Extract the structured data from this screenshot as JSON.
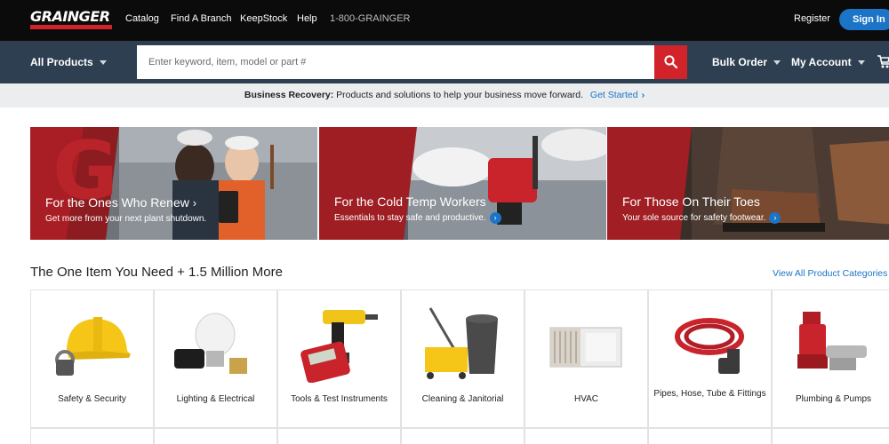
{
  "header": {
    "logo": "GRAINGER",
    "links": [
      "Catalog",
      "Find A Branch",
      "KeepStock",
      "Help"
    ],
    "phone": "1-800-GRAINGER",
    "register": "Register",
    "signin": "Sign In"
  },
  "nav": {
    "all_products": "All Products",
    "search_placeholder": "Enter keyword, item, model or part #",
    "bulk_order": "Bulk Order",
    "my_account": "My Account"
  },
  "banner": {
    "bold": "Business Recovery:",
    "text": "Products and solutions to help your business move forward.",
    "link": "Get Started"
  },
  "promos": [
    {
      "title": "For the Ones Who Renew",
      "subtitle": "Get more from your next plant shutdown."
    },
    {
      "title": "For the Cold Temp Workers",
      "subtitle": "Essentials to stay safe and productive."
    },
    {
      "title": "For Those On Their Toes",
      "subtitle": "Your sole source for safety footwear."
    }
  ],
  "section": {
    "title": "The One Item You Need + 1.5 Million More",
    "view_all": "View All Product Categories"
  },
  "categories": [
    {
      "label": "Safety & Security"
    },
    {
      "label": "Lighting & Electrical"
    },
    {
      "label": "Tools & Test Instruments"
    },
    {
      "label": "Cleaning & Janitorial"
    },
    {
      "label": "HVAC"
    },
    {
      "label": "Pipes, Hose, Tube & Fittings"
    },
    {
      "label": "Plumbing & Pumps"
    }
  ],
  "colors": {
    "brand_red": "#d2232a",
    "nav_bg": "#2d3f50",
    "link_blue": "#1b74c5"
  }
}
